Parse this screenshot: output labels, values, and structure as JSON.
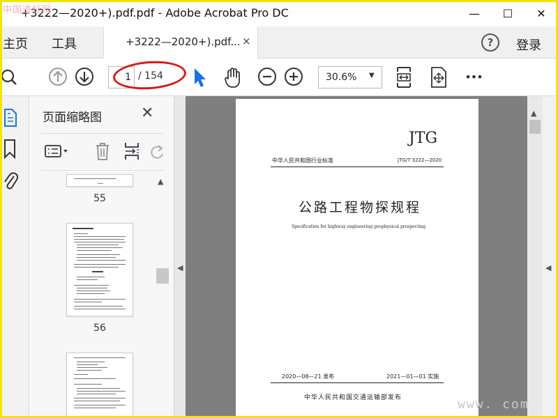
{
  "watermark_top": "中国道标网",
  "watermark_bottom": "www.      com",
  "window": {
    "title": "+3222—2020+).pdf.pdf - Adobe Acrobat Pro DC",
    "minimize": "—",
    "maximize": "☐",
    "close": "✕"
  },
  "tabs": {
    "home": "主页",
    "tools": "工具",
    "document_tab": "+3222—2020+).pdf...",
    "document_tab_close": "×"
  },
  "header_right": {
    "help": "?",
    "login": "登录"
  },
  "toolbar": {
    "current_page": "1",
    "total_pages": "/ 154",
    "zoom": "30.6%",
    "zoom_caret": "▼",
    "more": "•••"
  },
  "thumb_panel": {
    "title": "页面缩略图",
    "close": "✕",
    "pages": [
      "55",
      "56"
    ]
  },
  "document": {
    "code": "JTG",
    "category": "中华人民共和国行业标准",
    "standard_number": "JTG/T  3222—2020",
    "title_cn": "公路工程物探规程",
    "title_en": "Specification for highway engineering geophysical prospecting",
    "issued": "2020—08—21  发布",
    "effective": "2021—01—01  实施",
    "issuer": "中华人民共和国交通运输部发布"
  },
  "colors": {
    "accent_select": "#1473e6",
    "annotation": "#d81818",
    "frame": "#f2e600"
  }
}
